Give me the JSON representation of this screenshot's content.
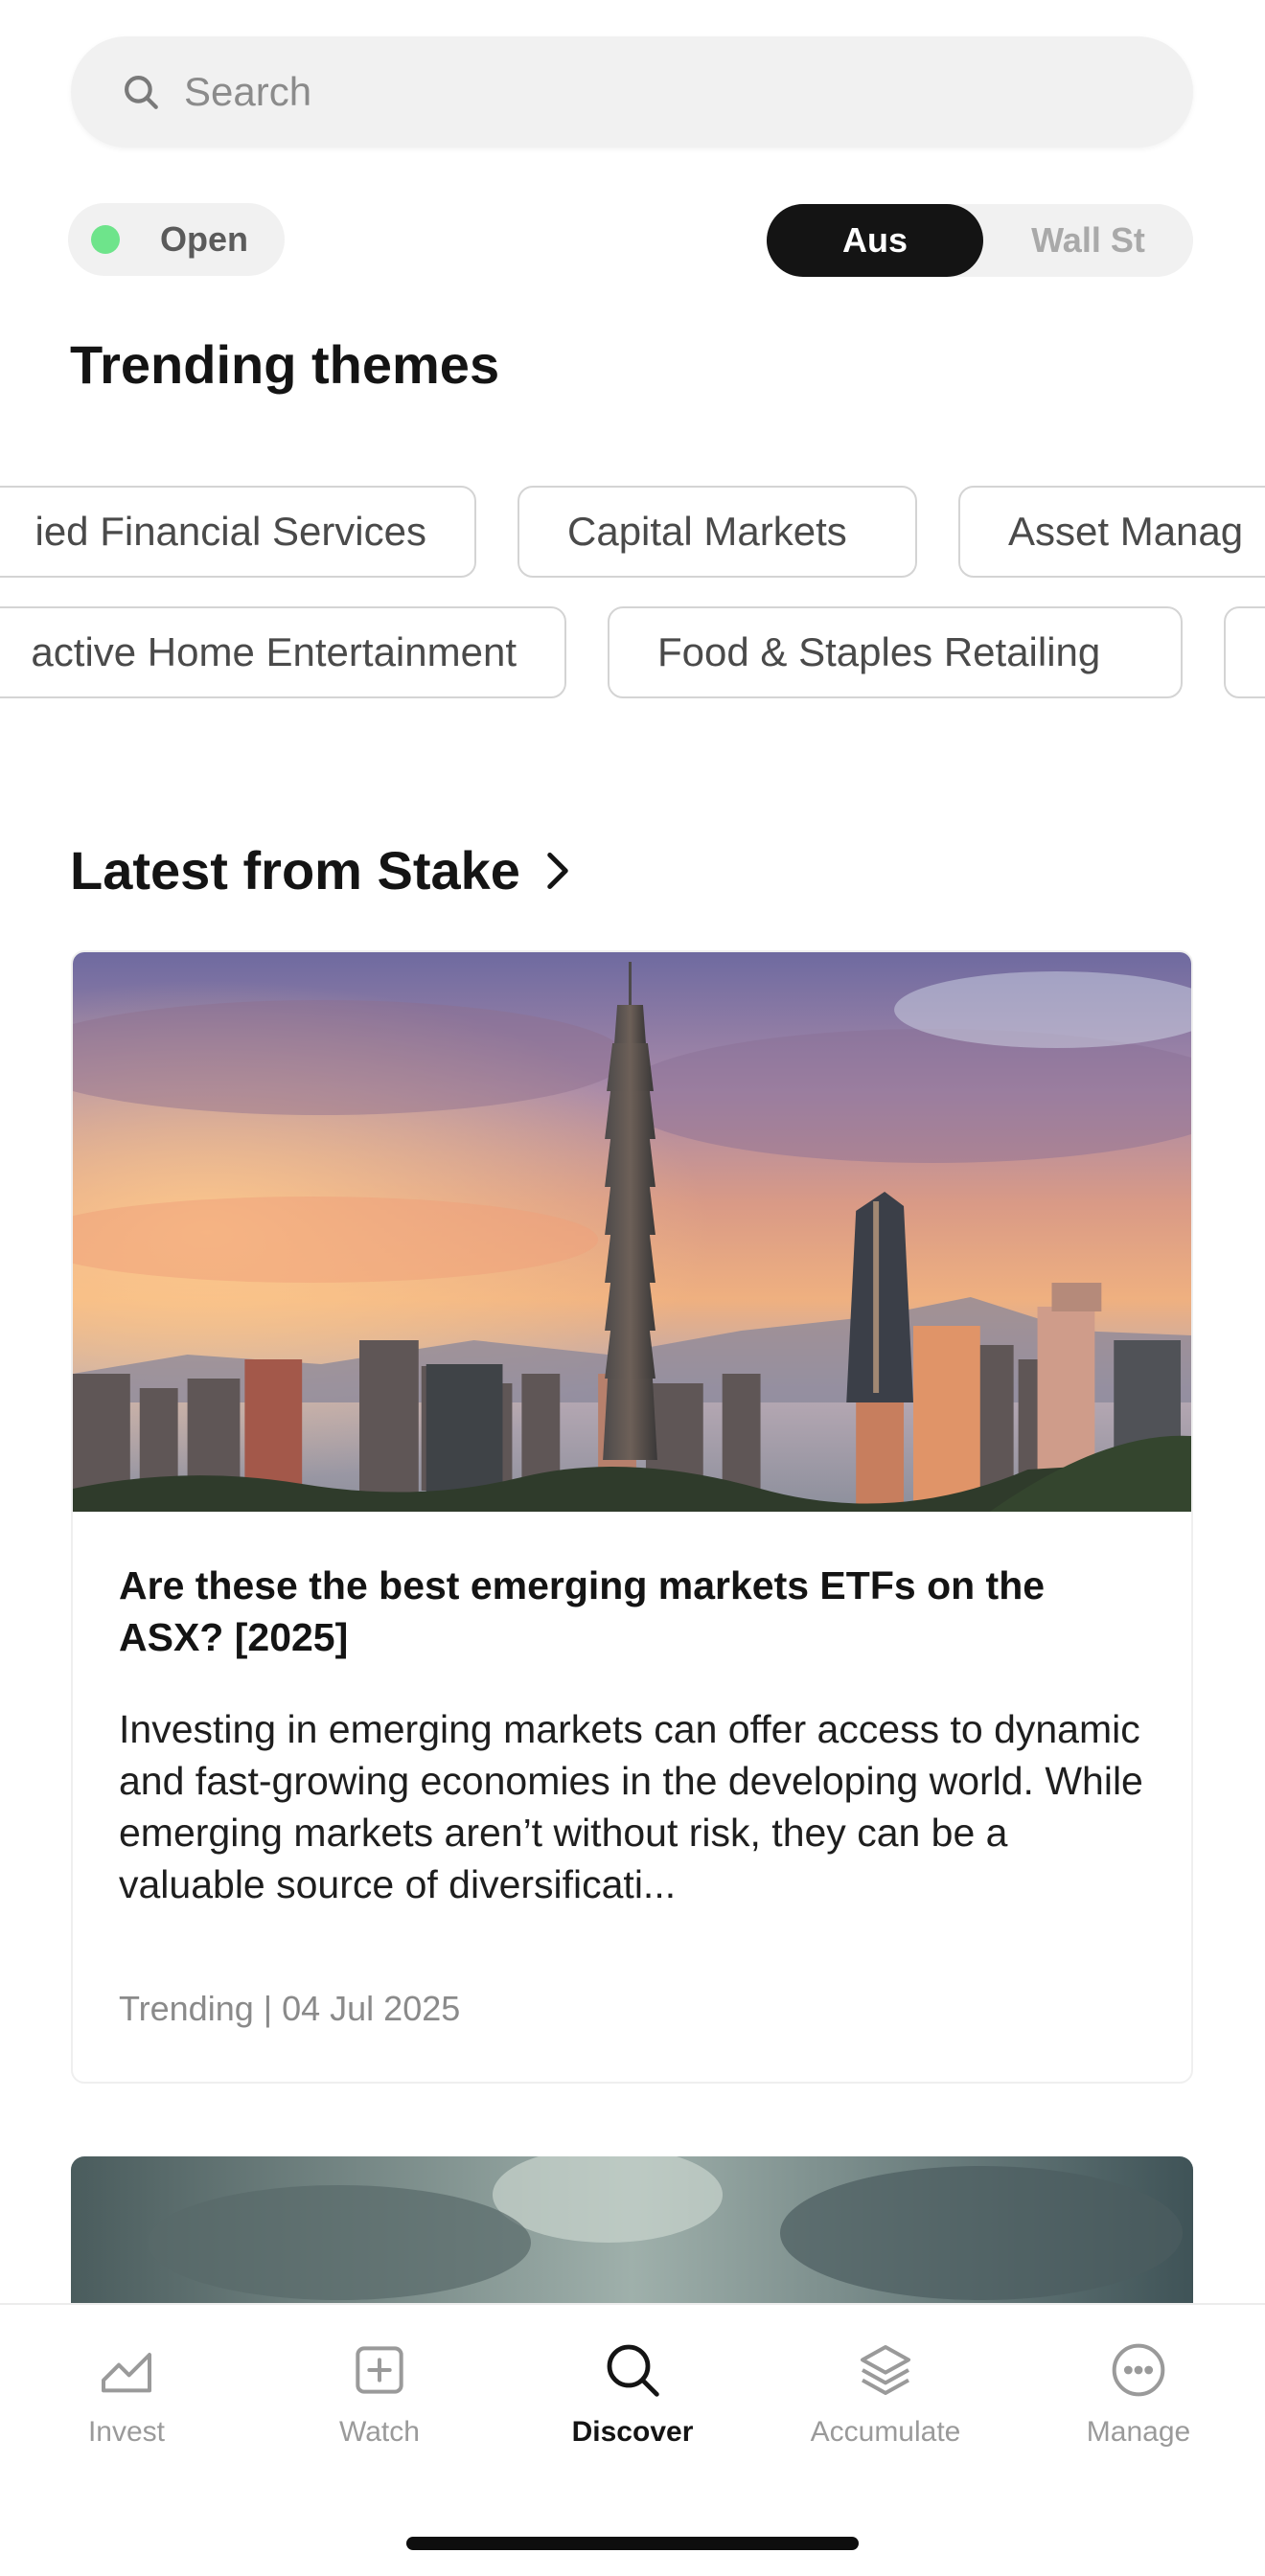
{
  "search": {
    "placeholder": "Search"
  },
  "market_status": {
    "label": "Open",
    "color": "#6ee48b"
  },
  "exchange_toggle": {
    "selected": "Aus",
    "other": "Wall St"
  },
  "trending": {
    "title": "Trending themes",
    "row1": [
      "ied Financial Services",
      "Capital Markets",
      "Asset Manag"
    ],
    "row2": [
      "active Home Entertainment",
      "Food & Staples Retailing",
      ""
    ]
  },
  "latest": {
    "title": "Latest from Stake",
    "article": {
      "title": "Are these the best emerging markets ETFs on the ASX? [2025]",
      "excerpt": "Investing in emerging markets can offer access to dynamic and fast-growing economies in the developing world. While emerging markets aren’t without risk, they can be a valuable source of diversificati...",
      "meta": "Trending | 04 Jul 2025"
    }
  },
  "nav": {
    "items": [
      {
        "label": "Invest",
        "icon": "chart-icon"
      },
      {
        "label": "Watch",
        "icon": "add-square-icon"
      },
      {
        "label": "Discover",
        "icon": "search-icon",
        "active": true
      },
      {
        "label": "Accumulate",
        "icon": "layers-icon"
      },
      {
        "label": "Manage",
        "icon": "more-circle-icon"
      }
    ]
  }
}
